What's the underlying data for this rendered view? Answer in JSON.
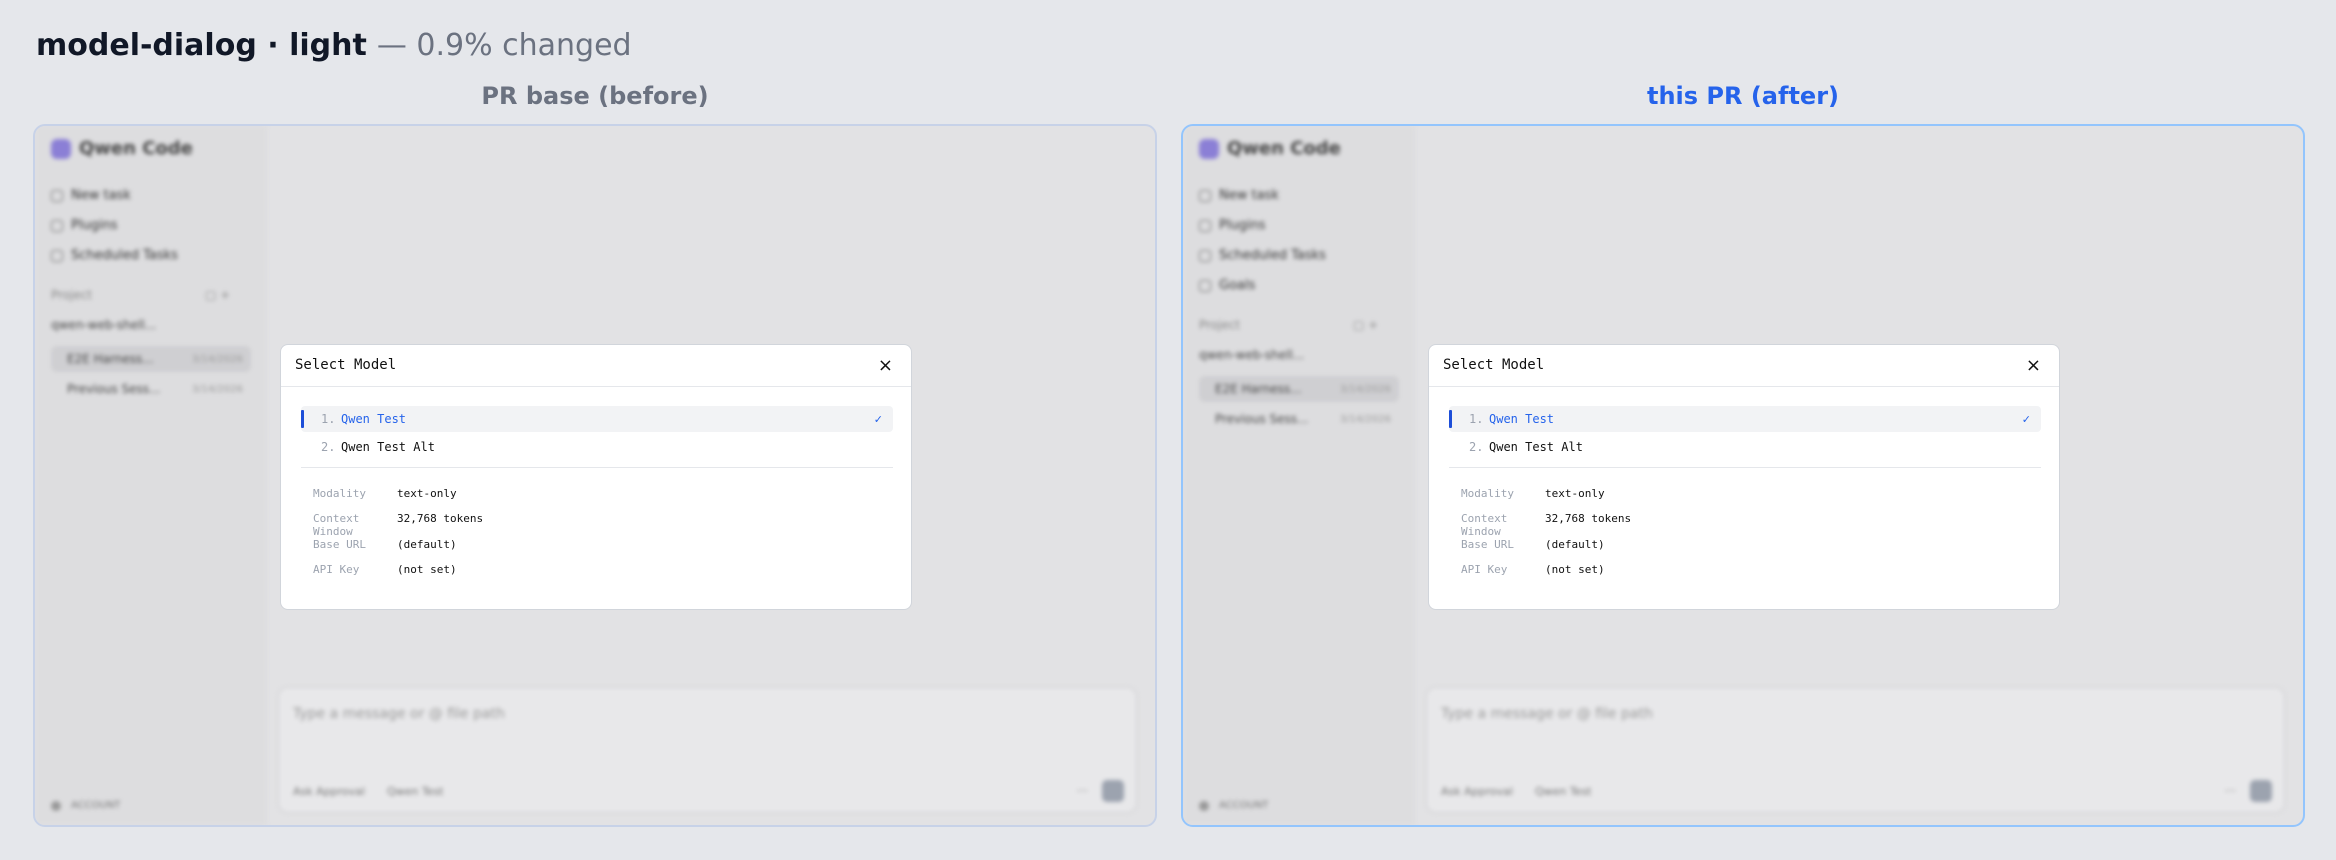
{
  "header": {
    "title": "model-dialog · light",
    "subtitle": "— 0.9% changed"
  },
  "columns": {
    "before_label": "PR base (before)",
    "after_label": "this PR (after)"
  },
  "app": {
    "name": "Qwen Code",
    "nav_before": [
      "New task",
      "Plugins",
      "Scheduled Tasks"
    ],
    "nav_after": [
      "New task",
      "Plugins",
      "Scheduled Tasks",
      "Goals"
    ],
    "projects_label": "Project",
    "folder": "qwen-web-shell...",
    "sessions": [
      {
        "title": "E2E Harness...",
        "time": "3/14/2026"
      },
      {
        "title": "Previous Sess...",
        "time": "3/14/2026"
      }
    ],
    "footer": "ACCOUNT",
    "composer_placeholder": "Type a message or @ file path",
    "chip_approval": "Ask Approval",
    "chip_model": "Qwen Test",
    "composer_more": "···"
  },
  "dialog": {
    "title": "Select Model",
    "close_glyph": "×",
    "check_glyph": "✓",
    "options": [
      {
        "num": "1.",
        "label": "Qwen Test"
      },
      {
        "num": "2.",
        "label": "Qwen Test Alt"
      }
    ],
    "details": [
      {
        "key": "Modality",
        "value": "text-only"
      },
      {
        "key": "Context Window",
        "value": "32,768 tokens"
      },
      {
        "key": "Base URL",
        "value": "(default)"
      },
      {
        "key": "API Key",
        "value": "(not set)"
      }
    ]
  }
}
